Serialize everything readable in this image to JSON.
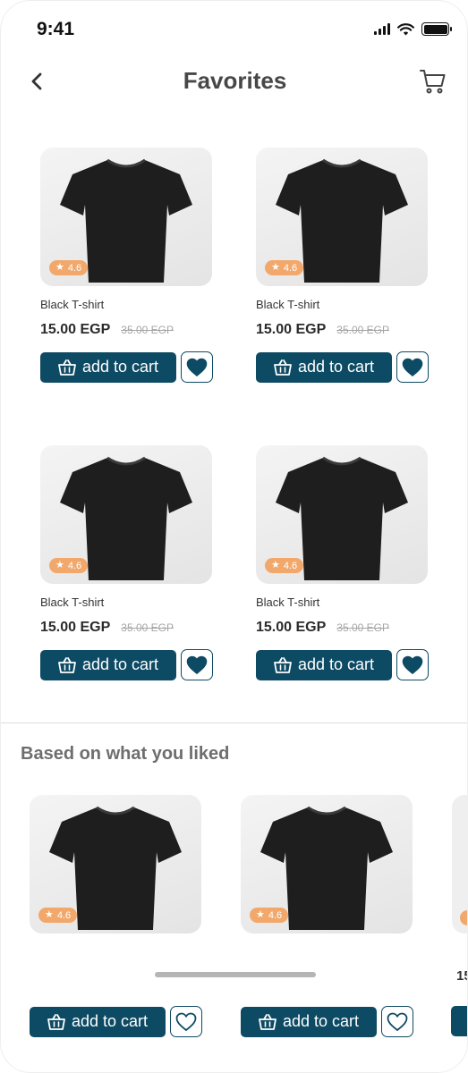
{
  "status_bar": {
    "time": "9:41"
  },
  "header": {
    "title": "Favorites"
  },
  "favorites": [
    {
      "name": "Black T-shirt",
      "rating": "4.6",
      "price": "15.00 EGP",
      "old_price": "35.00 EGP",
      "add_label": "add to cart"
    },
    {
      "name": "Black T-shirt",
      "rating": "4.6",
      "price": "15.00 EGP",
      "old_price": "35.00 EGP",
      "add_label": "add to cart"
    },
    {
      "name": "Black T-shirt",
      "rating": "4.6",
      "price": "15.00 EGP",
      "old_price": "35.00 EGP",
      "add_label": "add to cart"
    },
    {
      "name": "Black T-shirt",
      "rating": "4.6",
      "price": "15.00 EGP",
      "old_price": "35.00 EGP",
      "add_label": "add to cart"
    }
  ],
  "recommendations": {
    "title": "Based on what you liked",
    "items": [
      {
        "rating": "4.6",
        "add_label": "add to cart"
      },
      {
        "rating": "4.6",
        "add_label": "add to cart"
      }
    ],
    "peek_price": "15"
  },
  "colors": {
    "primary": "#0d4a63",
    "rating_badge": "#f2a86b"
  },
  "icons": {
    "back": "chevron-left-icon",
    "cart": "cart-icon",
    "basket": "basket-icon",
    "heart": "heart-icon",
    "star": "star-icon"
  }
}
